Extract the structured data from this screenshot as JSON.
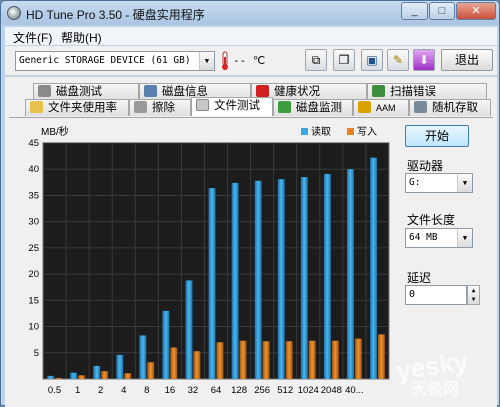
{
  "window": {
    "title": "HD Tune Pro 3.50 - 硬盘实用程序"
  },
  "menu": {
    "file": "文件(F)",
    "help": "帮助(H)"
  },
  "toolbar": {
    "device": "Generic STORAGE DEVICE (61 GB)",
    "temperature": "-- ℃",
    "exit_label": "退出",
    "icons": [
      "copy-icon",
      "copy-screen-icon",
      "save-icon",
      "options-icon",
      "download-icon"
    ]
  },
  "tabs": {
    "row1": [
      {
        "label": "磁盘测试",
        "icon": "drive-icon",
        "color": "#8a8a8a"
      },
      {
        "label": "磁盘信息",
        "icon": "info-icon",
        "color": "#5a7fb0"
      },
      {
        "label": "健康状况",
        "icon": "health-plus-icon",
        "color": "#d12020"
      },
      {
        "label": "扫描错误",
        "icon": "magnifier-icon",
        "color": "#3e8c3e"
      }
    ],
    "row2": [
      {
        "label": "文件夹使用率",
        "icon": "folder-icon",
        "color": "#e8c14a"
      },
      {
        "label": "擦除",
        "icon": "eraser-icon",
        "color": "#9a9a9a"
      },
      {
        "label": "文件测试",
        "icon": "file-icon",
        "color": "#c8c8c8"
      },
      {
        "label": "磁盘监测",
        "icon": "monitor-icon",
        "color": "#3e9e3e"
      },
      {
        "label": "AAM",
        "icon": "speaker-icon",
        "color": "#d9a200"
      },
      {
        "label": "随机存取",
        "icon": "random-access-icon",
        "color": "#7a8a9a"
      }
    ],
    "active": "文件测试"
  },
  "side": {
    "start_label": "开始",
    "drive_label": "驱动器",
    "drive_value": "G:",
    "file_length_label": "文件长度",
    "file_length_value": "64 MB",
    "delay_label": "延迟",
    "delay_value": "0"
  },
  "chart_data": {
    "type": "bar",
    "ylabel": "MB/秒",
    "ylim": [
      0,
      45
    ],
    "yticks": [
      5,
      10,
      15,
      20,
      25,
      30,
      35,
      40,
      45
    ],
    "categories": [
      "0.5",
      "1",
      "2",
      "4",
      "8",
      "16",
      "32",
      "64",
      "128",
      "256",
      "512",
      "1024",
      "2048",
      "40..."
    ],
    "series": [
      {
        "name": "读取",
        "color": "#3aa8e0",
        "values": [
          0.6,
          1.2,
          2.5,
          4.6,
          8.3,
          13.0,
          18.8,
          36.4,
          37.4,
          37.8,
          38.1,
          38.5,
          39.1,
          40.0,
          42.2
        ]
      },
      {
        "name": "写入",
        "color": "#e8821e",
        "values": [
          0.2,
          0.7,
          1.5,
          1.1,
          3.2,
          6.0,
          5.3,
          7.0,
          7.3,
          7.2,
          7.2,
          7.3,
          7.3,
          7.7,
          8.5
        ]
      }
    ],
    "background": "#1c1c1c",
    "grid": true,
    "legend_position": "top-right"
  },
  "watermark": {
    "line1": "yesky",
    "line2": "天极网"
  }
}
